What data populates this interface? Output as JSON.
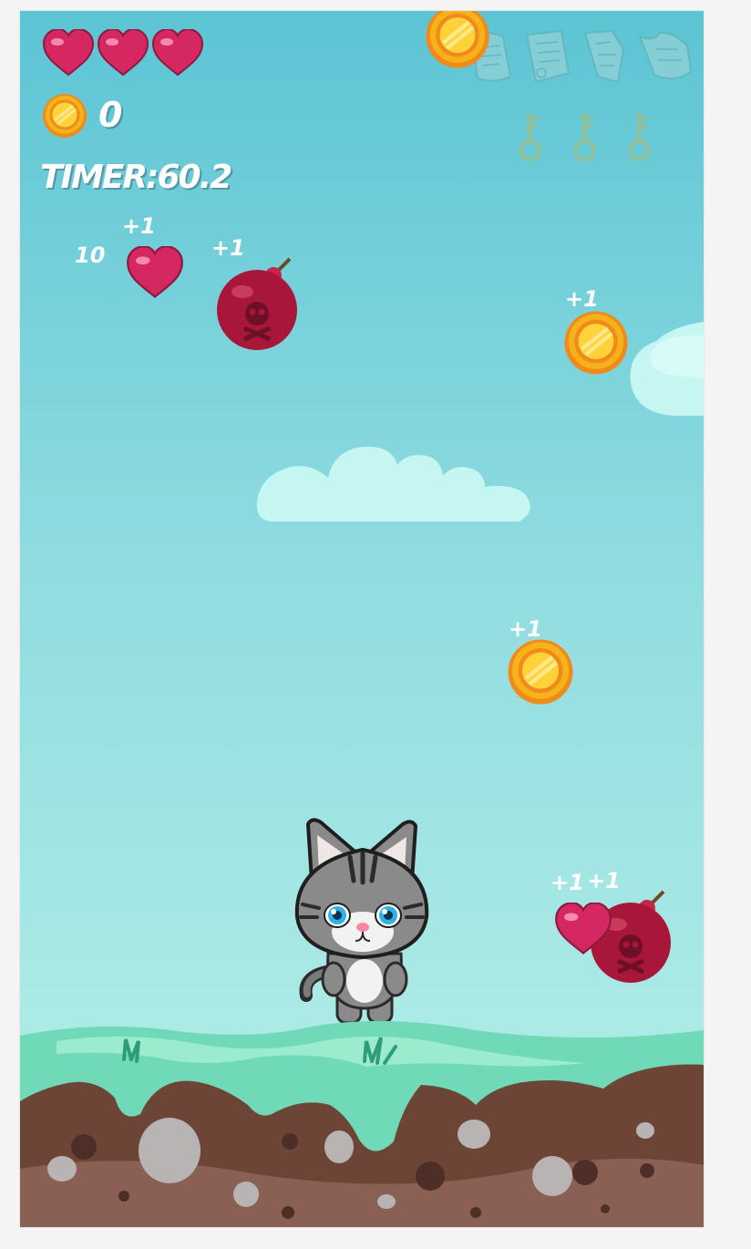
{
  "hud": {
    "lives": [
      {
        "id": "life-1",
        "icon": "heart-icon"
      },
      {
        "id": "life-2",
        "icon": "heart-icon"
      },
      {
        "id": "life-3",
        "icon": "heart-icon"
      }
    ],
    "coin_count": "0",
    "timer_label": "TIMER:",
    "timer_value": "60.2"
  },
  "collectibles": {
    "scroll_icons": [
      "scroll-piece-1-icon",
      "scroll-piece-2-icon",
      "scroll-piece-3-icon",
      "scroll-piece-4-icon"
    ],
    "key_icons": [
      "key-1-icon",
      "key-2-icon",
      "key-3-icon"
    ]
  },
  "popups": {
    "score_10": "10",
    "plus_one": "+1"
  },
  "colors": {
    "sky_top": "#5cc4d4",
    "sky_bottom": "#b8f0e8",
    "heart": "#d62860",
    "bomb": "#a8173a",
    "coin": "#f5b21a",
    "grass": "#6fd9b8",
    "dirt": "#6d4537"
  }
}
